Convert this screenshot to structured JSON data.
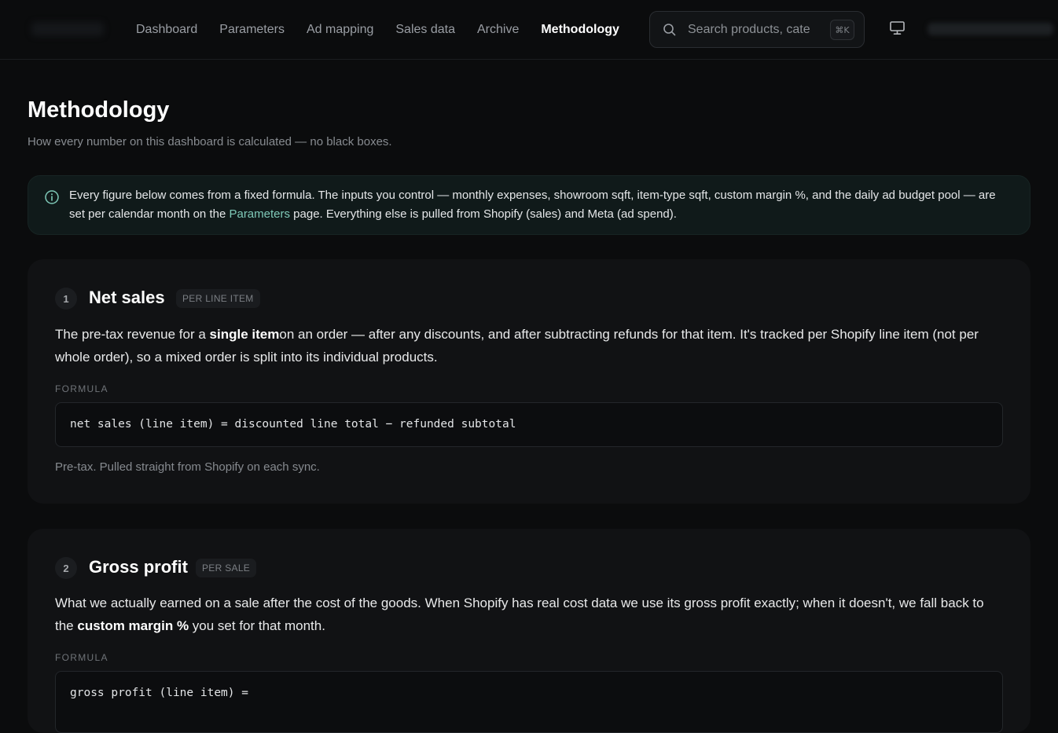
{
  "nav": {
    "items": [
      "Dashboard",
      "Parameters",
      "Ad mapping",
      "Sales data",
      "Archive",
      "Methodology"
    ],
    "active": "Methodology"
  },
  "search": {
    "placeholder": "Search products, categories",
    "shortcut": "⌘K"
  },
  "page": {
    "title": "Methodology",
    "subtitle": "How every number on this dashboard is calculated — no black boxes."
  },
  "info": {
    "text_before": "Every figure below comes from a fixed formula. The inputs you control — monthly expenses, showroom sqft, item-type sqft, custom margin %, and the daily ad budget pool — are set per calendar month on the ",
    "link": "Parameters",
    "text_after": " page. Everything else is pulled from Shopify (sales) and Meta (ad spend)."
  },
  "sections": [
    {
      "number": "1",
      "title": "Net sales",
      "tag": "PER LINE ITEM",
      "desc_a": "The pre-tax revenue for a ",
      "desc_bold": "single item",
      "desc_b": "on an order — after any discounts, and after subtracting refunds for that item. It's tracked per Shopify line item (not per whole order), so a mixed order is split into its individual products.",
      "formula_label": "FORMULA",
      "formula": "net sales (line item) = discounted line total − refunded subtotal",
      "note": "Pre-tax. Pulled straight from Shopify on each sync."
    },
    {
      "number": "2",
      "title": "Gross profit",
      "tag": "PER SALE",
      "desc_a": "What we actually earned on a sale after the cost of the goods. When Shopify has real cost data we use its gross profit exactly; when it doesn't, we fall back to the ",
      "desc_bold": "custom margin %",
      "desc_b": " you set for that month.",
      "formula_label": "FORMULA",
      "formula": "gross profit (line item) ="
    }
  ]
}
